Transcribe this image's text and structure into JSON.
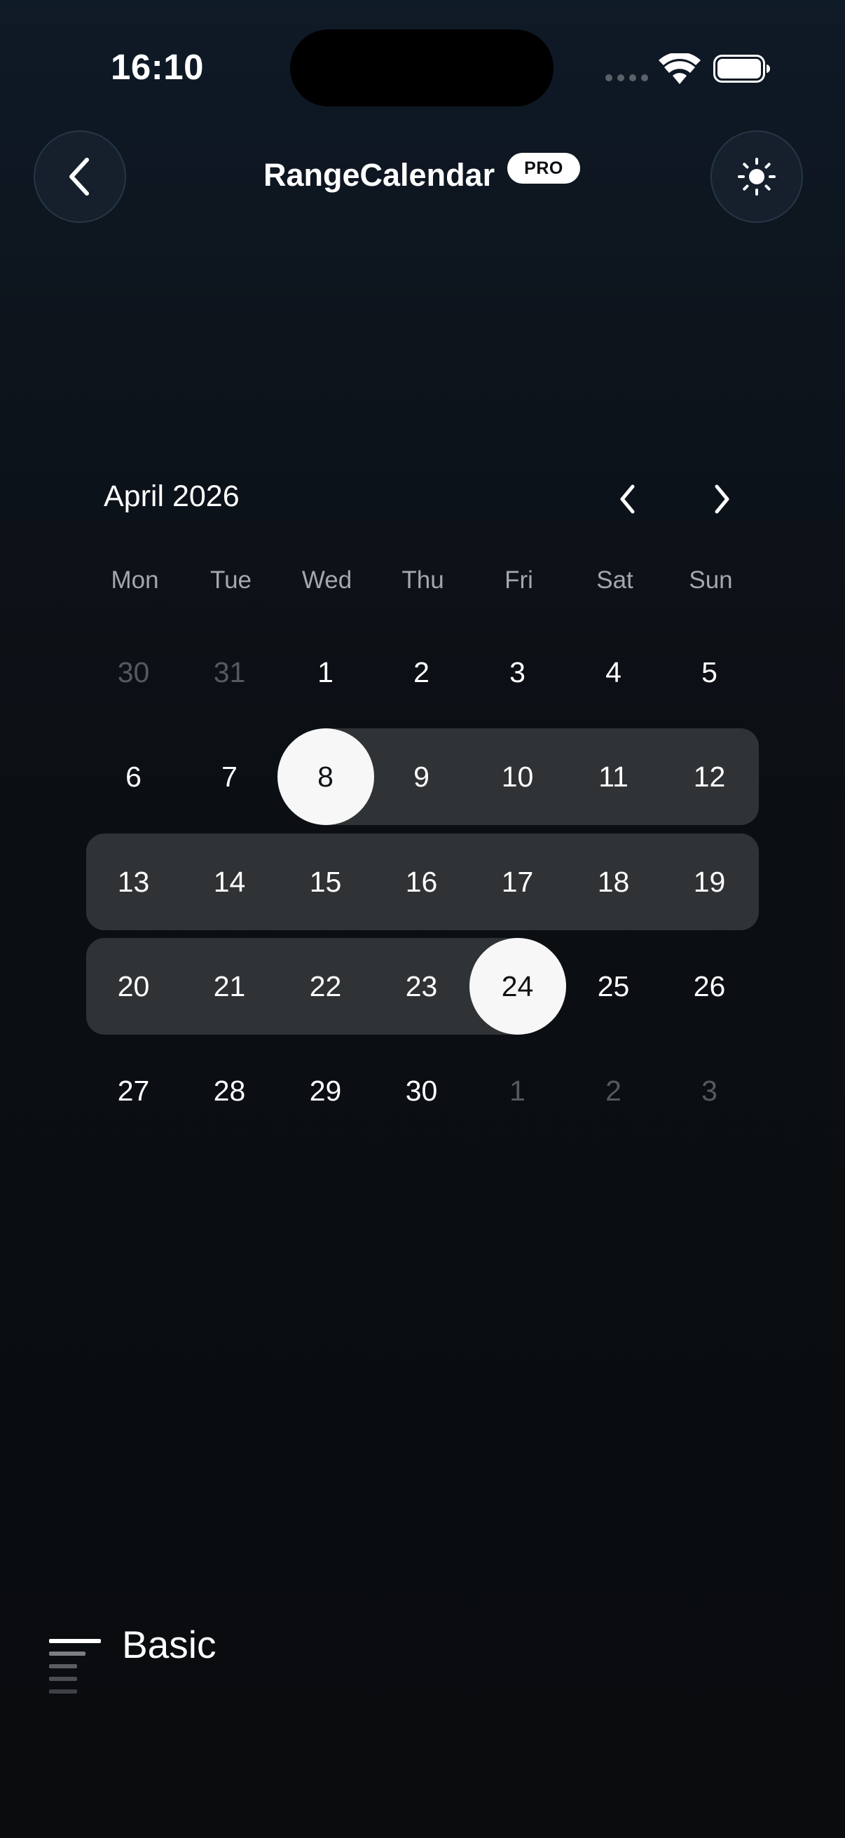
{
  "status_bar": {
    "time": "16:10",
    "icons": [
      "signal-dots-icon",
      "wifi-icon",
      "battery-icon"
    ]
  },
  "header": {
    "title": "RangeCalendar",
    "badge": "PRO",
    "back_icon": "chevron-left-icon",
    "theme_icon": "sun-icon"
  },
  "calendar": {
    "month_label": "April 2026",
    "prev_icon": "chevron-left-icon",
    "next_icon": "chevron-right-icon",
    "weekdays": [
      "Mon",
      "Tue",
      "Wed",
      "Thu",
      "Fri",
      "Sat",
      "Sun"
    ],
    "weeks": [
      [
        "30",
        "31",
        "1",
        "2",
        "3",
        "4",
        "5"
      ],
      [
        "6",
        "7",
        "8",
        "9",
        "10",
        "11",
        "12"
      ],
      [
        "13",
        "14",
        "15",
        "16",
        "17",
        "18",
        "19"
      ],
      [
        "20",
        "21",
        "22",
        "23",
        "24",
        "25",
        "26"
      ],
      [
        "27",
        "28",
        "29",
        "30",
        "1",
        "2",
        "3"
      ]
    ],
    "range_start": "8",
    "range_end": "24"
  },
  "footer": {
    "section_label": "Basic",
    "section_icon": "lines-icon"
  },
  "colors": {
    "background": "#0a0c0f",
    "range_band": "#303335",
    "selected": "#f7f7f7",
    "muted_text": "#55595d"
  }
}
